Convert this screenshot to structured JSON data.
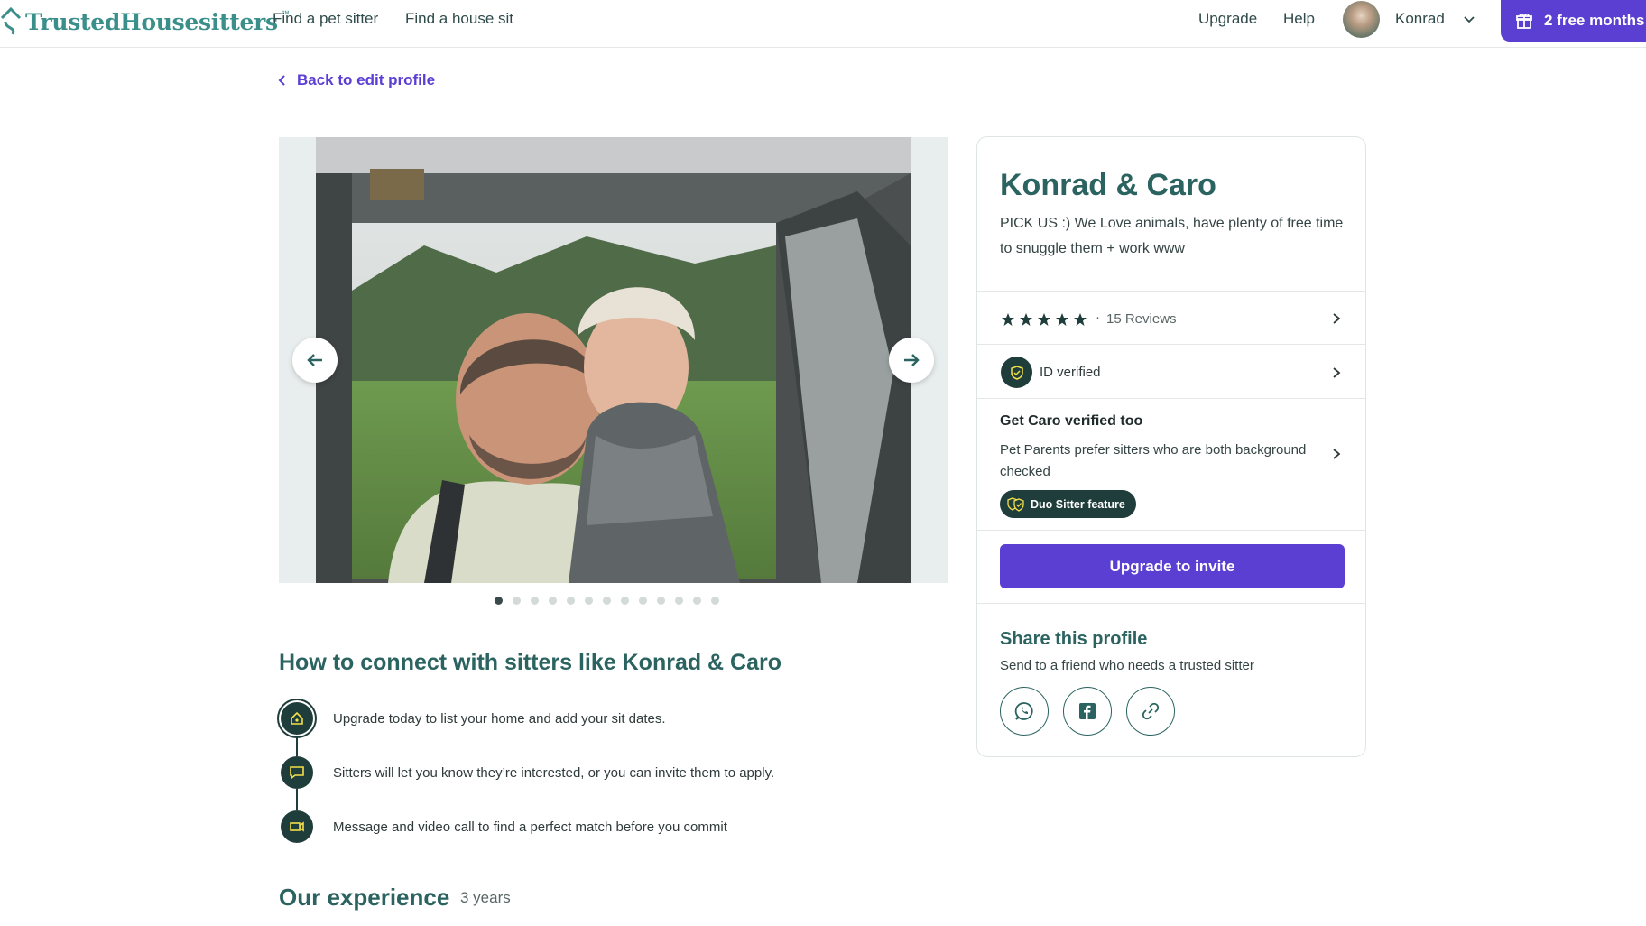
{
  "header": {
    "logo_text": "TrustedHousesitters",
    "logo_tm": "™",
    "nav": [
      "Find a pet sitter",
      "Find a house sit"
    ],
    "right_links": [
      "Upgrade",
      "Help"
    ],
    "user_name": "Konrad",
    "promo_label": "2 free months"
  },
  "back_link": "Back to edit profile",
  "gallery": {
    "photo_count": 13,
    "active_index": 0
  },
  "connect": {
    "title": "How to connect with sitters like Konrad & Caro",
    "steps": [
      {
        "icon": "home-icon",
        "text": "Upgrade today to list your home and add your sit dates."
      },
      {
        "icon": "chat-icon",
        "text": "Sitters will let you know they’re interested, or you can invite them to apply."
      },
      {
        "icon": "video-icon",
        "text": "Message and video call to find a perfect match before you commit"
      }
    ]
  },
  "experience": {
    "title": "Our experience",
    "years": "3 years"
  },
  "profile_card": {
    "name": "Konrad & Caro",
    "bio": "PICK US :) We Love animals, have plenty of free time to snuggle them + work www",
    "rating": 5,
    "reviews_separator": "·",
    "reviews": "15 Reviews",
    "id_verified": "ID verified",
    "caro_title": "Get Caro verified too",
    "caro_desc": "Pet Parents prefer sitters who are both background checked",
    "duo_feature": "Duo Sitter feature",
    "upgrade_button": "Upgrade to invite",
    "share_title": "Share this profile",
    "share_desc": "Send to a friend who needs a trusted sitter",
    "share_options": [
      "whatsapp-icon",
      "facebook-icon",
      "link-icon"
    ]
  },
  "colors": {
    "brand_teal": "#3a8f8a",
    "heading_teal": "#2b6360",
    "primary_purple": "#5b3fd3",
    "dark_green": "#1f3d3a"
  }
}
